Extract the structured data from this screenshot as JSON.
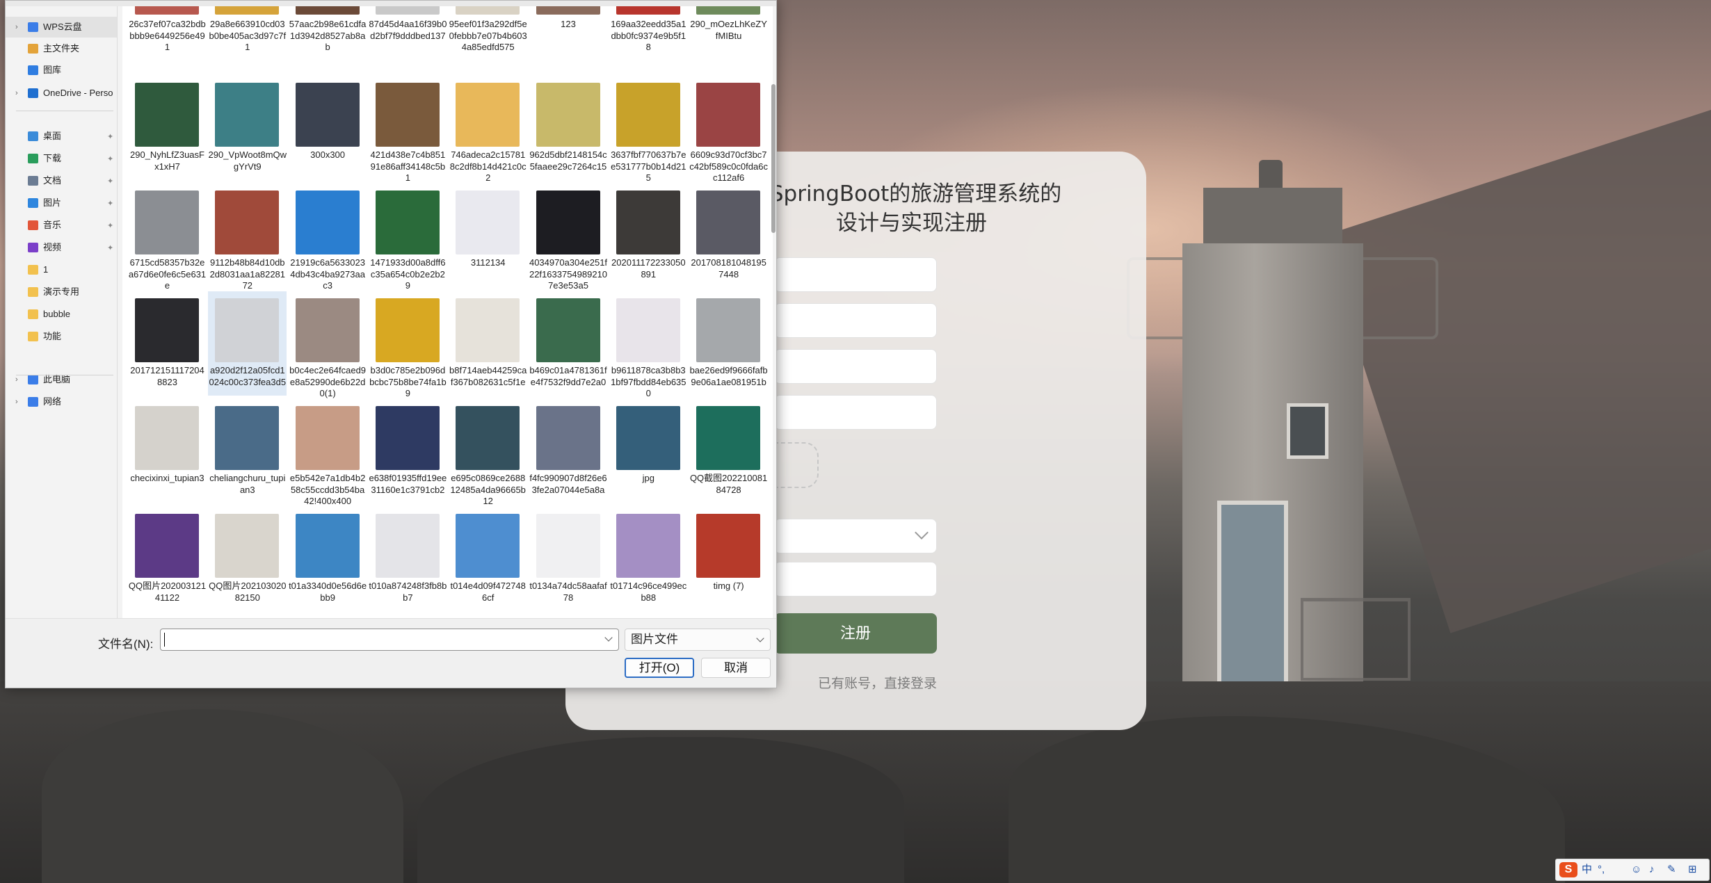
{
  "register": {
    "title_line1": "]SpringBoot的旅游管理系统的",
    "title_line2": "设计与实现注册",
    "submit_label": "注册",
    "login_link": "已有账号，直接登录"
  },
  "dialog": {
    "nav": [
      {
        "label": "WPS云盘",
        "icon": "cloud-icon",
        "color": "#3b7de8",
        "expand": true,
        "selected": true
      },
      {
        "label": "主文件夹",
        "icon": "home-icon",
        "color": "#e3a33a",
        "expand": false
      },
      {
        "label": "图库",
        "icon": "gallery-icon",
        "color": "#2f7de1",
        "expand": false
      },
      {
        "label": "OneDrive - Perso",
        "icon": "onedrive-icon",
        "color": "#1f6fd0",
        "expand": true
      },
      {
        "label": "桌面",
        "icon": "desktop-icon",
        "color": "#3a8bd9",
        "pin": true
      },
      {
        "label": "下载",
        "icon": "download-icon",
        "color": "#2a9d5c",
        "pin": true
      },
      {
        "label": "文档",
        "icon": "document-icon",
        "color": "#6b7c93",
        "pin": true
      },
      {
        "label": "图片",
        "icon": "pictures-icon",
        "color": "#2e86de",
        "pin": true
      },
      {
        "label": "音乐",
        "icon": "music-icon",
        "color": "#e2563a",
        "pin": true
      },
      {
        "label": "视频",
        "icon": "video-icon",
        "color": "#7b3fc9",
        "pin": true
      },
      {
        "label": "1",
        "icon": "folder-icon",
        "color": "#f2c14e"
      },
      {
        "label": "演示专用",
        "icon": "folder-icon",
        "color": "#f2c14e"
      },
      {
        "label": "bubble",
        "icon": "folder-icon",
        "color": "#f2c14e"
      },
      {
        "label": "功能",
        "icon": "folder-icon",
        "color": "#f2c14e"
      },
      {
        "label": "此电脑",
        "icon": "computer-icon",
        "color": "#3b7de8",
        "expand": true
      },
      {
        "label": "网络",
        "icon": "network-icon",
        "color": "#3b7de8",
        "expand": true
      }
    ],
    "files": [
      [
        {
          "name": "26c37ef07ca32bdbbbb9e6449256e491",
          "color": "#b7584e"
        },
        {
          "name": "29a8e663910cd03b0be405ac3d97c7f1",
          "color": "#d5a33a"
        },
        {
          "name": "57aac2b98e61cdfa1d3942d8527ab8ab",
          "color": "#6b4a38"
        },
        {
          "name": "87d45d4aa16f39b0d2bf7f9dddbed137",
          "color": "#c9c9c9"
        },
        {
          "name": "95eef01f3a292df5e0febbb7e07b4b6034a85edfd575",
          "color": "#d9d2c4"
        },
        {
          "name": "123",
          "color": "#8a6b5c"
        },
        {
          "name": "169aa32eedd35a1dbb0fc9374e9b5f18",
          "color": "#b8352d"
        },
        {
          "name": "290_mOezLhKeZYfMIBtu",
          "color": "#6e8b5c"
        }
      ],
      [
        {
          "name": "290_NyhLfZ3uasFx1xH7",
          "color": "#2f5a3d"
        },
        {
          "name": "290_VpWoot8mQwgYrVt9",
          "color": "#3d7f86"
        },
        {
          "name": "300x300",
          "color": "#3b4250"
        },
        {
          "name": "421d438e7c4b85191e86aff34148c5b1",
          "color": "#7a5a3c"
        },
        {
          "name": "746adeca2c157818c2df8b14d421c0c2",
          "color": "#e8b85a"
        },
        {
          "name": "962d5dbf2148154c5faaee29c7264c15",
          "color": "#c8b96a"
        },
        {
          "name": "3637fbf770637b7ee531777b0b14d215",
          "color": "#c8a22a"
        },
        {
          "name": "6609c93d70cf3bc7c42bf589c0c0fda6cc112af6",
          "color": "#9a4444"
        }
      ],
      [
        {
          "name": "6715cd58357b32ea67d6e0fe6c5e631e",
          "color": "#8b8e93"
        },
        {
          "name": "9112b48b84d10db2d8031aa1a8228172",
          "color": "#a04a3a"
        },
        {
          "name": "21919c6a56330234db43c4ba9273aac3",
          "color": "#2a7ed0"
        },
        {
          "name": "1471933d00a8dff6c35a654c0b2e2b29",
          "color": "#2a6b3a"
        },
        {
          "name": "3112134",
          "color": "#e9e9ef"
        },
        {
          "name": "4034970a304e251f22f16337549892107e3e53a5",
          "color": "#1d1d22"
        },
        {
          "name": "202011172233050891",
          "color": "#3d3a38"
        },
        {
          "name": "2017081810481957448",
          "color": "#5a5a64"
        }
      ],
      [
        {
          "name": "2017121511172048823",
          "color": "#2a2a2e"
        },
        {
          "name": "a920d2f12a05fcd1024c00c373fea3d5",
          "color": "#d0d2d6",
          "selected": true
        },
        {
          "name": "b0c4ec2e64fcaed9e8a52990de6b22d0(1)",
          "color": "#9b8a82"
        },
        {
          "name": "b3d0c785e2b096dbcbc75b8be74fa1b9",
          "color": "#d8a822"
        },
        {
          "name": "b8f714aeb44259caf367b082631c5f1e",
          "color": "#e6e2da"
        },
        {
          "name": "b469c01a4781361fe4f7532f9dd7e2a0",
          "color": "#3a6b4d"
        },
        {
          "name": "b9611878ca3b8b31bf97fbdd84eb6350",
          "color": "#e8e4ea"
        },
        {
          "name": "bae26ed9f9666fafb9e06a1ae081951b",
          "color": "#a5a8ab"
        }
      ],
      [
        {
          "name": "checixinxi_tupian3",
          "color": "#d5d2cc"
        },
        {
          "name": "cheliangchuru_tupian3",
          "color": "#4a6b88"
        },
        {
          "name": "e5b542e7a1db4b258c55ccdd3b54ba42!400x400",
          "color": "#c79c86"
        },
        {
          "name": "e638f01935ffd19ee31160e1c3791cb2",
          "color": "#2e3a62"
        },
        {
          "name": "e695c0869ce268812485a4da96665b12",
          "color": "#34515e"
        },
        {
          "name": "f4fc990907d8f26e63fe2a07044e5a8a",
          "color": "#6a7389"
        },
        {
          "name": "jpg",
          "color": "#345f7a"
        },
        {
          "name": "QQ截图20221008184728",
          "color": "#1d6e5c"
        }
      ],
      [
        {
          "name": "QQ图片20200312141122",
          "color": "#5c3a86"
        },
        {
          "name": "QQ图片20210302082150",
          "color": "#d9d5cd"
        },
        {
          "name": "t01a3340d0e56d6ebb9",
          "color": "#3d86c4"
        },
        {
          "name": "t010a874248f3fb8bb7",
          "color": "#e4e4e8"
        },
        {
          "name": "t014e4d09f4727486cf",
          "color": "#4e8ed0"
        },
        {
          "name": "t0134a74dc58aafaf78",
          "color": "#f0f0f2"
        },
        {
          "name": "t01714c96ce499ecb88",
          "color": "#a48fc4"
        },
        {
          "name": "timg (7)",
          "color": "#b63a2a"
        }
      ]
    ],
    "filename_label": "文件名(N):",
    "filename_value": "",
    "filetype_value": "图片文件",
    "open_label": "打开(O)",
    "cancel_label": "取消"
  },
  "ime": {
    "logo": "S",
    "lang": "中",
    "punct": "°,",
    "items": [
      "☺",
      "♪",
      "✎",
      "⊞"
    ]
  }
}
